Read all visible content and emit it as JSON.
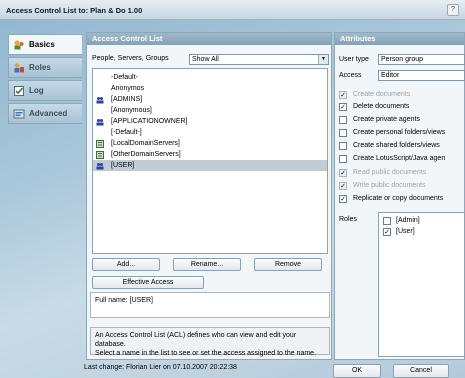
{
  "window": {
    "title": "Access Control List to: Plan & Do 1.00",
    "help": "?"
  },
  "tabs": [
    {
      "label": "Basics",
      "icon": "basics-icon"
    },
    {
      "label": "Roles",
      "icon": "roles-icon"
    },
    {
      "label": "Log",
      "icon": "log-icon"
    },
    {
      "label": "Advanced",
      "icon": "advanced-icon"
    }
  ],
  "acl": {
    "header": "Access Control List",
    "filter_label": "People, Servers, Groups",
    "filter_value": "Show All",
    "entries": [
      {
        "name": "-Default-",
        "icon": ""
      },
      {
        "name": "Anonymos",
        "icon": ""
      },
      {
        "name": "[ADMINS]",
        "icon": "person-group-icon"
      },
      {
        "name": "[Anonymous]",
        "icon": ""
      },
      {
        "name": "[APPLICATIONOWNER]",
        "icon": "person-group-icon"
      },
      {
        "name": "[-Default-]",
        "icon": ""
      },
      {
        "name": "[LocalDomainServers]",
        "icon": "server-group-icon"
      },
      {
        "name": "[OtherDomainServers]",
        "icon": "server-group-icon"
      },
      {
        "name": "[USER]",
        "icon": "person-group-icon"
      }
    ],
    "selected_entry": "[USER]",
    "add_label": "Add...",
    "rename_label": "Rename...",
    "remove_label": "Remove",
    "effective_access_label": "Effective Access",
    "fullname_text": "Full name: [USER]",
    "help_text_line1": "An Access Control List (ACL) defines who can view and edit your database.",
    "help_text_line2": "Select a name in the list to see or set the access assigned to the name."
  },
  "attributes": {
    "header": "Attributes",
    "user_type_label": "User type",
    "user_type_value": "Person group",
    "access_label": "Access",
    "access_value": "Editor",
    "options": [
      {
        "label": "Create documents",
        "checked": true,
        "enabled": false
      },
      {
        "label": "Delete documents",
        "checked": true,
        "enabled": true
      },
      {
        "label": "Create private agents",
        "checked": false,
        "enabled": true
      },
      {
        "label": "Create personal folders/views",
        "checked": false,
        "enabled": true
      },
      {
        "label": "Create shared folders/views",
        "checked": false,
        "enabled": true
      },
      {
        "label": "Create LotusScript/Java agen",
        "checked": false,
        "enabled": true
      },
      {
        "label": "Read public documents",
        "checked": true,
        "enabled": false
      },
      {
        "label": "Write public documents",
        "checked": true,
        "enabled": false
      },
      {
        "label": "Replicate or copy documents",
        "checked": true,
        "enabled": true
      }
    ],
    "roles_label": "Roles",
    "roles": [
      {
        "label": "[Admin]",
        "checked": false
      },
      {
        "label": "[User]",
        "checked": true
      }
    ]
  },
  "footer": {
    "last_change": "Last change: Florian Lier on 07.10.2007 20:22:38",
    "ok_label": "OK",
    "cancel_label": "Cancel"
  }
}
